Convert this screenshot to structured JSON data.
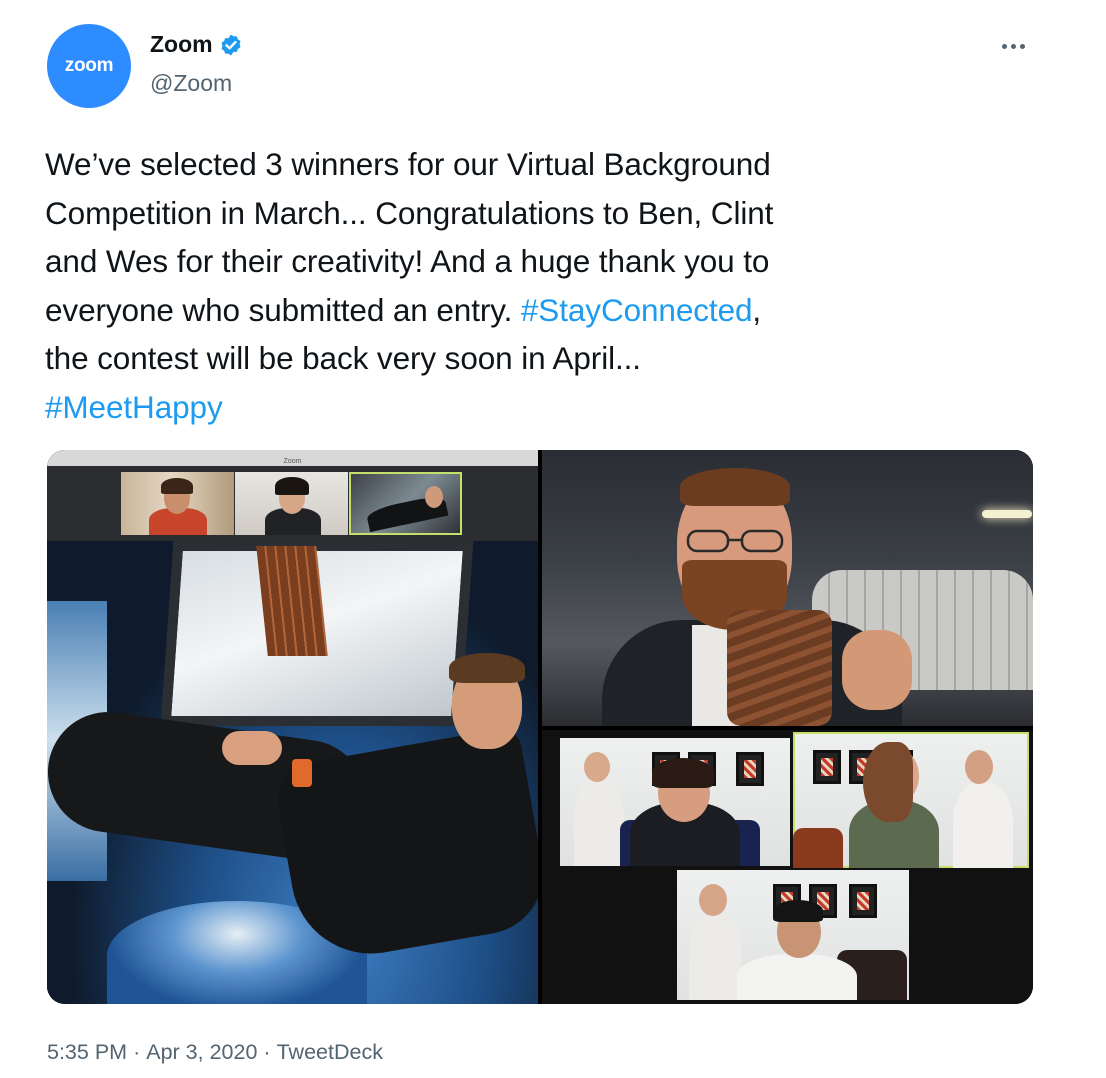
{
  "author": {
    "avatar_text": "zoom",
    "display_name": "Zoom",
    "handle": "@Zoom",
    "verified": true
  },
  "tweet": {
    "lines": [
      {
        "text": "We’ve selected 3 winners for our Virtual Background"
      },
      {
        "text": "Competition in March... Congratulations to Ben, Clint"
      },
      {
        "text": "and Wes for their creativity! And a huge thank you to"
      },
      {
        "pre": "everyone who submitted an entry. ",
        "hashtag": "#StayConnected",
        "post": ","
      },
      {
        "text": "the contest will be back very soon in April..."
      },
      {
        "hashtag": "#MeetHappy"
      }
    ]
  },
  "media": {
    "zoom_window_title": "Zoom"
  },
  "meta": {
    "time": "5:35 PM",
    "separator": "·",
    "date": "Apr 3, 2020",
    "source": "TweetDeck"
  },
  "colors": {
    "brand": "#2d8cff",
    "hashtag": "#1d9bf0",
    "verified": "#1d9bf0",
    "muted": "#536471",
    "highlight": "#c4e06b"
  },
  "icons": {
    "verified": "verified-badge-icon",
    "more": "more-options-icon"
  }
}
